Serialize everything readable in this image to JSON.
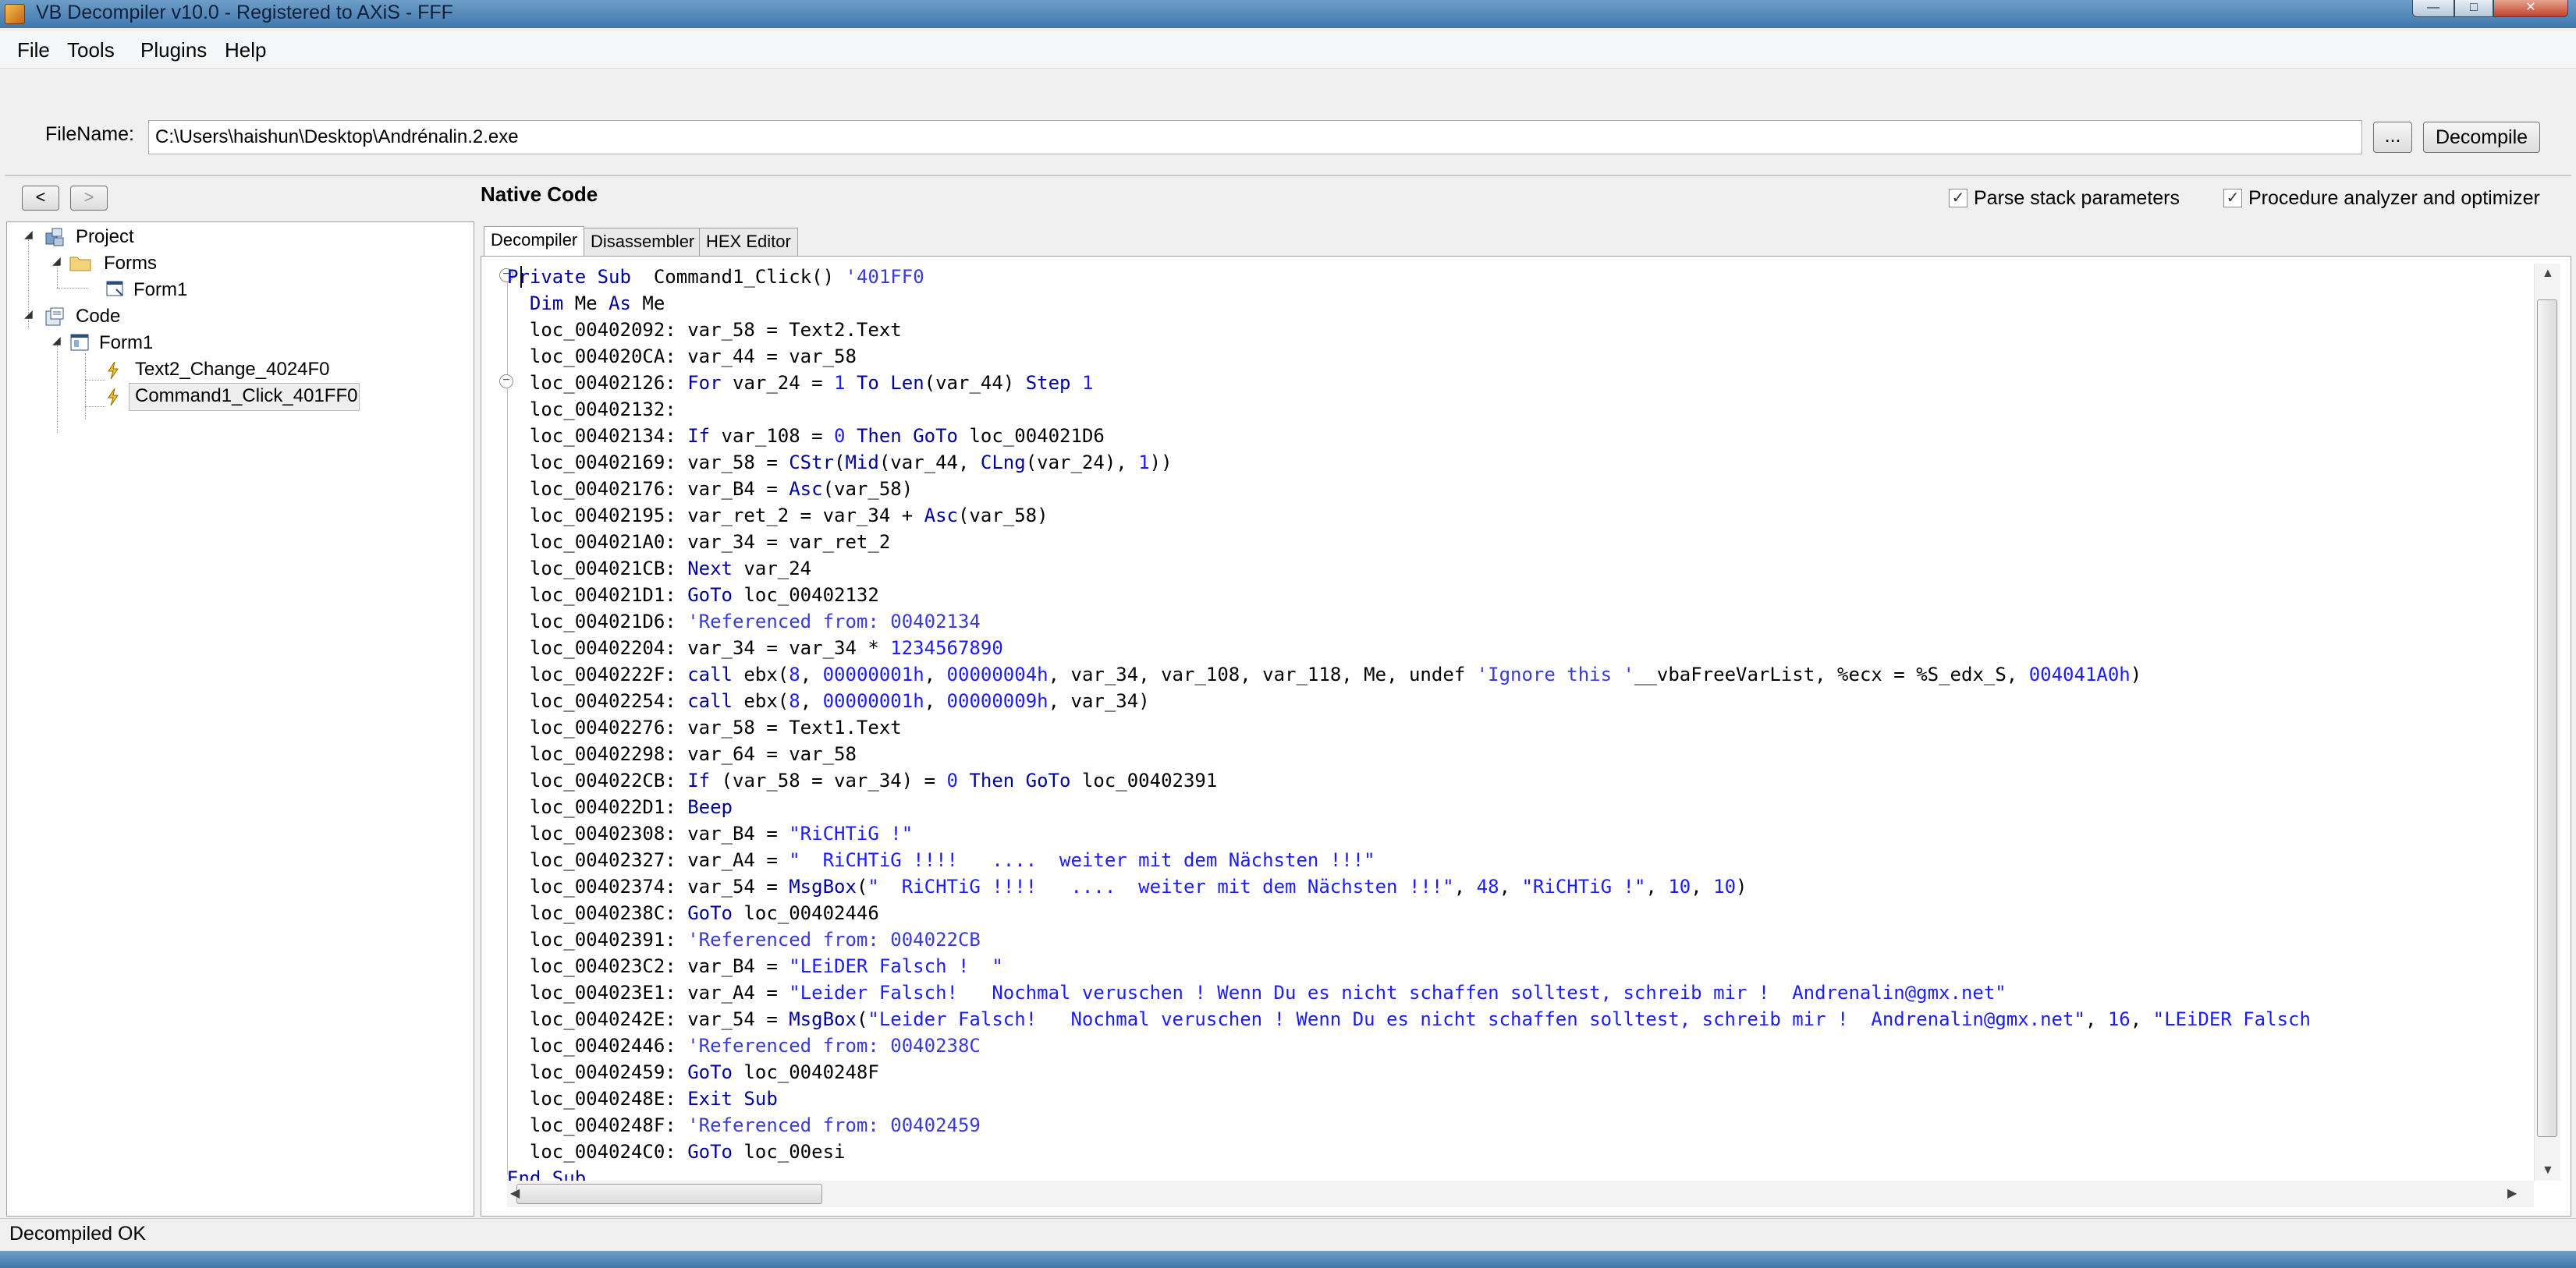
{
  "window": {
    "title": "VB Decompiler v10.0 - Registered to AXiS - FFF",
    "minimize": "—",
    "maximize": "□",
    "close": "✕"
  },
  "menu": [
    "File",
    "Tools",
    "Plugins",
    "Help"
  ],
  "file": {
    "label": "FileName:",
    "value": "C:\\Users\\haishun\\Desktop\\Andrénalin.2.exe",
    "browse": "...",
    "decompile": "Decompile"
  },
  "nav": {
    "back": "<",
    "forward": ">"
  },
  "header": {
    "section": "Native Code",
    "parse_stack": "Parse stack parameters",
    "procedure_analyzer": "Procedure analyzer and optimizer",
    "parse_checked": true,
    "procedure_checked": true
  },
  "tree": {
    "project": "Project",
    "forms": "Forms",
    "form1": "Form1",
    "code": "Code",
    "code_form1": "Form1",
    "text2_change": "Text2_Change_4024F0",
    "command1_click": "Command1_Click_401FF0"
  },
  "tabs": [
    "Decompiler",
    "Disassembler",
    "HEX Editor"
  ],
  "code_lines": [
    [
      [
        "kw",
        "Private Sub"
      ],
      [
        "",
        "  Command1_Click() "
      ],
      [
        "cmt",
        "'401FF0"
      ]
    ],
    [
      [
        "",
        "  "
      ],
      [
        "kw",
        "Dim"
      ],
      [
        "",
        " Me "
      ],
      [
        "kw",
        "As"
      ],
      [
        "",
        " Me"
      ]
    ],
    [
      [
        "",
        "  loc_00402092: var_58 = Text2.Text"
      ]
    ],
    [
      [
        "",
        "  loc_004020CA: var_44 = var_58"
      ]
    ],
    [
      [
        "",
        "  loc_00402126: "
      ],
      [
        "kw",
        "For"
      ],
      [
        "",
        " var_24 = "
      ],
      [
        "num",
        "1"
      ],
      [
        "kw",
        " To "
      ],
      [
        "kw",
        "Len"
      ],
      [
        "",
        "(var_44) "
      ],
      [
        "kw",
        "Step"
      ],
      [
        "num",
        " 1"
      ]
    ],
    [
      [
        "",
        "  loc_00402132:"
      ]
    ],
    [
      [
        "",
        "  loc_00402134: "
      ],
      [
        "kw",
        "If"
      ],
      [
        "",
        " var_108 = "
      ],
      [
        "num",
        "0"
      ],
      [
        "kw",
        " Then GoTo"
      ],
      [
        "",
        " loc_004021D6"
      ]
    ],
    [
      [
        "",
        "  loc_00402169: var_58 = "
      ],
      [
        "kw",
        "CStr"
      ],
      [
        "",
        "("
      ],
      [
        "kw",
        "Mid"
      ],
      [
        "",
        "(var_44, "
      ],
      [
        "kw",
        "CLng"
      ],
      [
        "",
        "(var_24), "
      ],
      [
        "num",
        "1"
      ],
      [
        "",
        "))"
      ]
    ],
    [
      [
        "",
        "  loc_00402176: var_B4 = "
      ],
      [
        "kw",
        "Asc"
      ],
      [
        "",
        "(var_58)"
      ]
    ],
    [
      [
        "",
        "  loc_00402195: var_ret_2 = var_34 + "
      ],
      [
        "kw",
        "Asc"
      ],
      [
        "",
        "(var_58)"
      ]
    ],
    [
      [
        "",
        "  loc_004021A0: var_34 = var_ret_2"
      ]
    ],
    [
      [
        "",
        "  loc_004021CB: "
      ],
      [
        "kw",
        "Next"
      ],
      [
        "",
        " var_24"
      ]
    ],
    [
      [
        "",
        "  loc_004021D1: "
      ],
      [
        "kw",
        "GoTo"
      ],
      [
        "",
        " loc_00402132"
      ]
    ],
    [
      [
        "",
        "  loc_004021D6: "
      ],
      [
        "cmt",
        "'Referenced from: 00402134"
      ]
    ],
    [
      [
        "",
        "  loc_00402204: var_34 = var_34 * "
      ],
      [
        "num",
        "1234567890"
      ]
    ],
    [
      [
        "",
        "  loc_0040222F: "
      ],
      [
        "kw",
        "call"
      ],
      [
        "",
        " ebx("
      ],
      [
        "num",
        "8"
      ],
      [
        "",
        ", "
      ],
      [
        "num",
        "00000001h"
      ],
      [
        "",
        ", "
      ],
      [
        "num",
        "00000004h"
      ],
      [
        "",
        ", var_34, var_108, var_118, Me, undef "
      ],
      [
        "cmt",
        "'Ignore this '"
      ],
      [
        "",
        "__vbaFreeVarList, %ecx = %S_edx_S, "
      ],
      [
        "num",
        "004041A0h"
      ],
      [
        "",
        ")"
      ]
    ],
    [
      [
        "",
        "  loc_00402254: "
      ],
      [
        "kw",
        "call"
      ],
      [
        "",
        " ebx("
      ],
      [
        "num",
        "8"
      ],
      [
        "",
        ", "
      ],
      [
        "num",
        "00000001h"
      ],
      [
        "",
        ", "
      ],
      [
        "num",
        "00000009h"
      ],
      [
        "",
        ", var_34)"
      ]
    ],
    [
      [
        "",
        "  loc_00402276: var_58 = Text1.Text"
      ]
    ],
    [
      [
        "",
        "  loc_00402298: var_64 = var_58"
      ]
    ],
    [
      [
        "",
        "  loc_004022CB: "
      ],
      [
        "kw",
        "If"
      ],
      [
        "",
        " (var_58 = var_34) = "
      ],
      [
        "num",
        "0"
      ],
      [
        "kw",
        " Then GoTo"
      ],
      [
        "",
        " loc_00402391"
      ]
    ],
    [
      [
        "",
        "  loc_004022D1: "
      ],
      [
        "kw",
        "Beep"
      ]
    ],
    [
      [
        "",
        "  loc_00402308: var_B4 = "
      ],
      [
        "str",
        "\"RiCHTiG !\""
      ]
    ],
    [
      [
        "",
        "  loc_00402327: var_A4 = "
      ],
      [
        "str",
        "\"  RiCHTiG !!!!   ....  weiter mit dem Nächsten !!!\""
      ]
    ],
    [
      [
        "",
        "  loc_00402374: var_54 = "
      ],
      [
        "kw",
        "MsgBox"
      ],
      [
        "",
        "("
      ],
      [
        "str",
        "\"  RiCHTiG !!!!   ....  weiter mit dem Nächsten !!!\""
      ],
      [
        "",
        ", "
      ],
      [
        "num",
        "48"
      ],
      [
        "",
        ", "
      ],
      [
        "str",
        "\"RiCHTiG !\""
      ],
      [
        "",
        ", "
      ],
      [
        "num",
        "10"
      ],
      [
        "",
        ", "
      ],
      [
        "num",
        "10"
      ],
      [
        "",
        ")"
      ]
    ],
    [
      [
        "",
        "  loc_0040238C: "
      ],
      [
        "kw",
        "GoTo"
      ],
      [
        "",
        " loc_00402446"
      ]
    ],
    [
      [
        "",
        "  loc_00402391: "
      ],
      [
        "cmt",
        "'Referenced from: 004022CB"
      ]
    ],
    [
      [
        "",
        "  loc_004023C2: var_B4 = "
      ],
      [
        "str",
        "\"LEiDER Falsch !  \""
      ]
    ],
    [
      [
        "",
        "  loc_004023E1: var_A4 = "
      ],
      [
        "str",
        "\"Leider Falsch!   Nochmal veruschen ! Wenn Du es nicht schaffen solltest, schreib mir !  Andrenalin@gmx.net\""
      ]
    ],
    [
      [
        "",
        "  loc_0040242E: var_54 = "
      ],
      [
        "kw",
        "MsgBox"
      ],
      [
        "",
        "("
      ],
      [
        "str",
        "\"Leider Falsch!   Nochmal veruschen ! Wenn Du es nicht schaffen solltest, schreib mir !  Andrenalin@gmx.net\""
      ],
      [
        "",
        ", "
      ],
      [
        "num",
        "16"
      ],
      [
        "",
        ", "
      ],
      [
        "str",
        "\"LEiDER Falsch"
      ]
    ],
    [
      [
        "",
        "  loc_00402446: "
      ],
      [
        "cmt",
        "'Referenced from: 0040238C"
      ]
    ],
    [
      [
        "",
        "  loc_00402459: "
      ],
      [
        "kw",
        "GoTo"
      ],
      [
        "",
        " loc_0040248F"
      ]
    ],
    [
      [
        "",
        "  loc_0040248E: "
      ],
      [
        "kw",
        "Exit Sub"
      ]
    ],
    [
      [
        "",
        "  loc_0040248F: "
      ],
      [
        "cmt",
        "'Referenced from: 00402459"
      ]
    ],
    [
      [
        "",
        "  loc_004024C0: "
      ],
      [
        "kw",
        "GoTo"
      ],
      [
        "",
        " loc_00esi"
      ]
    ],
    [
      [
        "kw",
        "End Sub"
      ]
    ]
  ],
  "status": "Decompiled OK"
}
